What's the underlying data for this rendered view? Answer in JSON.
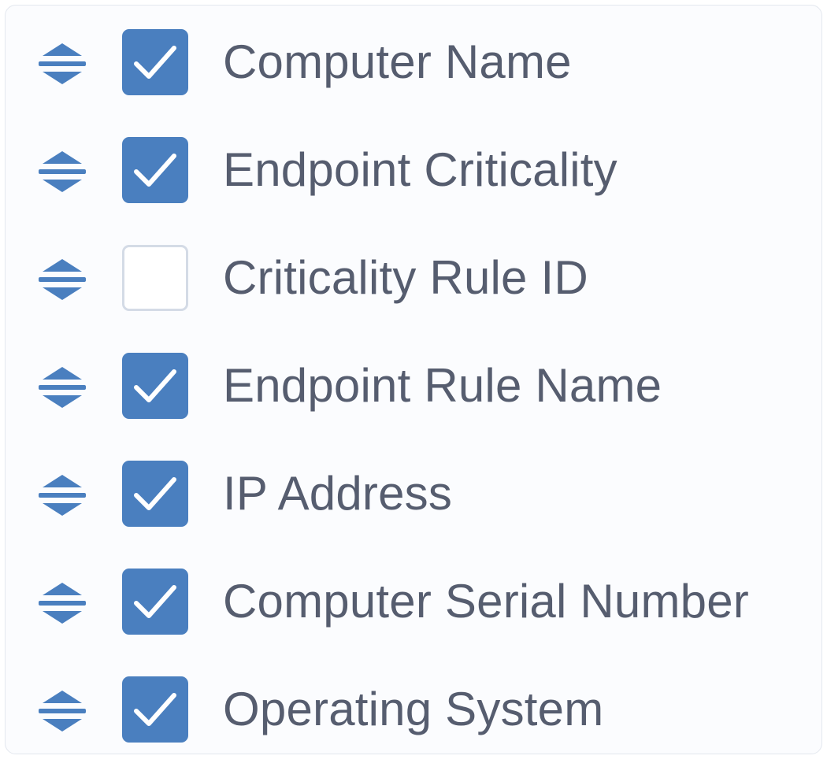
{
  "columns": [
    {
      "label": "Computer Name",
      "checked": true
    },
    {
      "label": "Endpoint Criticality",
      "checked": true
    },
    {
      "label": "Criticality Rule ID",
      "checked": false
    },
    {
      "label": "Endpoint Rule Name",
      "checked": true
    },
    {
      "label": "IP Address",
      "checked": true
    },
    {
      "label": "Computer Serial Number",
      "checked": true
    },
    {
      "label": "Operating System",
      "checked": true
    }
  ],
  "icons": {
    "drag": "drag-sort-icon",
    "check": "checkmark-icon"
  },
  "colors": {
    "accent": "#4a7fbf",
    "text": "#565d6f",
    "unchecked_border": "#d4dbe6",
    "panel_bg": "#fbfcfe"
  }
}
